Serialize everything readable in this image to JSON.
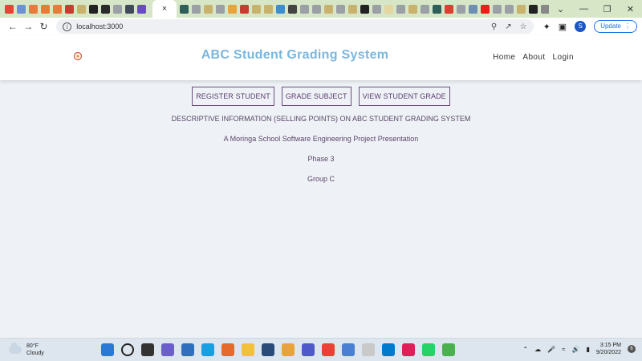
{
  "browser": {
    "url": "localhost:3000",
    "update_label": "Update",
    "profile_initial": "S",
    "new_tab_glyph": "+",
    "tab_close_glyph": "×",
    "active_tab_icon": "close-icon"
  },
  "site": {
    "title": "ABC Student Grading System",
    "nav": [
      "Home",
      "About",
      "Login"
    ]
  },
  "actions": [
    "REGISTER STUDENT",
    "GRADE SUBJECT",
    "VIEW STUDENT GRADE"
  ],
  "info": [
    "DESCRIPTIVE INFORMATION (SELLING POINTS) ON ABC STUDENT GRADING SYSTEM",
    "A Moringa School Software Engineering Project Presentation",
    "Phase 3",
    "Group C"
  ],
  "taskbar": {
    "weather_temp": "80°F",
    "weather_desc": "Cloudy",
    "time": "3:15 PM",
    "date": "9/20/2022",
    "notification_count": "6"
  },
  "colors": {
    "title": "#7ab6dd",
    "button_border": "#6b4d7d",
    "page_bg": "#eef2f6",
    "tabstrip_bg": "#d6e6c7"
  }
}
